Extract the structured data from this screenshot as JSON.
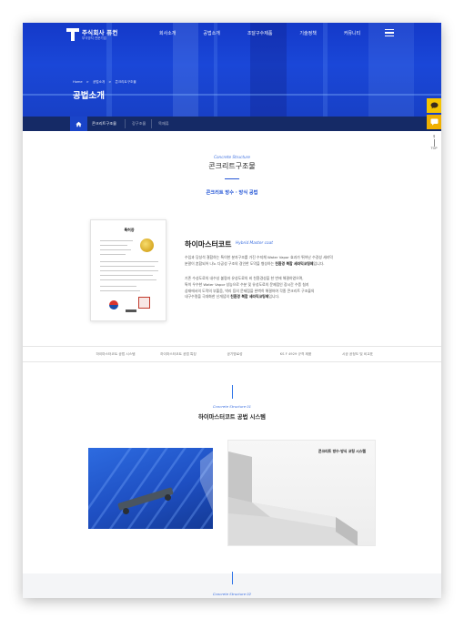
{
  "header": {
    "logo_name": "주식회사 퓨컨",
    "logo_sub": "부식방지 전문기업",
    "nav": [
      "회사소개",
      "공법소개",
      "조달구수제품",
      "기술정책",
      "커뮤니티"
    ],
    "breadcrumb": [
      "Home",
      ">",
      "공법소개",
      ">",
      "콘크리트구조물"
    ],
    "page_title": "공법소개"
  },
  "subnav": {
    "items": [
      "콘크리트구조물",
      "강구조물",
      "목재류"
    ]
  },
  "floating": {
    "top_label": "TOP"
  },
  "intro": {
    "eyebrow": "Concrete Structure",
    "title": "콘크리트구조물",
    "subtitle": "콘크리트 방수 · 방식 공법"
  },
  "certificate": {
    "title": "특허증"
  },
  "product": {
    "name": "하이마스터코트",
    "name_en": "Hybrid Master coat",
    "p1_a": "수입과 당성석 결합하는 특이한 분자구조를 가진 수지체 Water Vapor 효과가 뛰어난 수경성 세라믹",
    "p1_b": "분말이 혼합되어 나노 다공성 구조의 경인한 도막을 형성하는 ",
    "p1_strong": "친환경 복합 세라믹코팅제",
    "p1_end": "입니다.",
    "p2_a": "기존 수성도료의 내수성 불량과 유성도료의 비 친환경성을 한 번에 해결하였으며,",
    "p2_b": "특히 우수한 Water Vapor 성능으로 수분 및 유성도료의 문제점인 장시간 수증 침지",
    "p2_c": "상태에서의 도막의 부풀음, 박리 등의 문제점을 완벽히 해결하여 각종 콘크리트 구조물의",
    "p2_d": "내구수명을 극대화한 신개념의 ",
    "p2_strong": "친환경 복합 세라믹코팅제",
    "p2_end": "입니다."
  },
  "tabs": [
    "하이마스터코트 공법 시스템",
    "하이마스터코트 공법 특징",
    "공기명료성",
    "KS F 4929 규격 제품",
    "시공 공정도 및 비교표"
  ],
  "section2": {
    "eyebrow": "Concrete Structure 01",
    "title": "하이마스터코트 공법 시스템",
    "photo_caption": "콘크리트 방수·방식 코팅 시스템",
    "next_eyebrow": "Concrete Structure 02"
  },
  "colors": {
    "accent": "#2456d6",
    "hero": "#1a47d8",
    "subnav": "#152a66",
    "kakao": "#f5c400"
  }
}
